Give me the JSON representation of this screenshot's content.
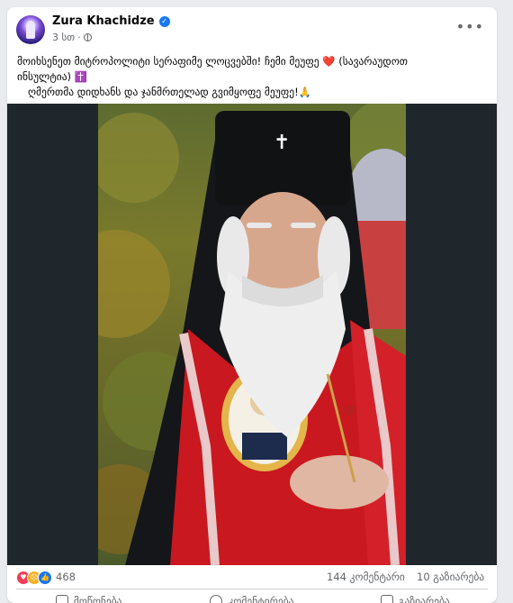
{
  "post": {
    "author": "Zura Khachidze",
    "time": "3 სთ",
    "separator": "·",
    "text_line1": "მოიხსენეთ მიტროპოლიტი სერაფიმე ლოცვებში! ჩემი მეუფე ❤️ (სავარაუდოთ",
    "text_line2": "ინსულტია) ✝️",
    "text_line3": "ღმერთმა დიდხანს და ჯანმრთელად გვიმყოფე მეუფე!🙏"
  },
  "stats": {
    "reaction_count": "468",
    "comments": "144 კომენტარი",
    "shares": "10 გაზიარება"
  },
  "actions": {
    "like": "მოწონება",
    "comment": "კომენტირება",
    "share": "გაზიარება"
  },
  "colors": {
    "accent": "#1877f2",
    "love": "#f33e58",
    "sad": "#f7b125"
  }
}
